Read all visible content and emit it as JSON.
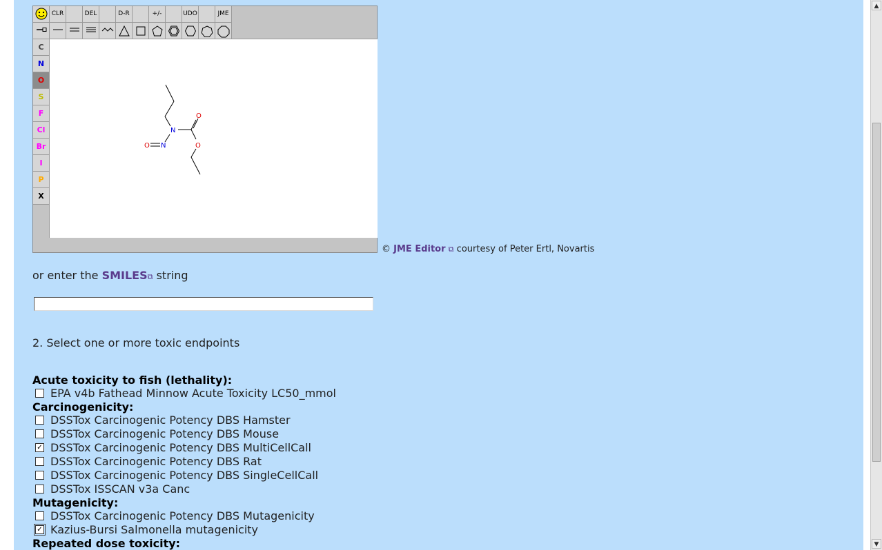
{
  "jme": {
    "top_buttons": [
      "",
      "CLR",
      "",
      "DEL",
      "",
      "D-R",
      "",
      "+/-",
      "",
      "UDO",
      "",
      "JME"
    ],
    "second_row_icons": [
      "chain-icon",
      "single-bond-icon",
      "double-bond-icon",
      "triple-bond-icon",
      "wavy-chain-icon",
      "triangle-ring-icon",
      "square-ring-icon",
      "pentagon-ring-icon",
      "benzene-ring-icon",
      "hexagon-ring-icon",
      "heptagon-ring-icon",
      "octagon-ring-icon"
    ],
    "atoms": [
      {
        "label": "C",
        "color": "#444444"
      },
      {
        "label": "N",
        "color": "#0000dd"
      },
      {
        "label": "O",
        "color": "#dd0000"
      },
      {
        "label": "S",
        "color": "#bbbb00"
      },
      {
        "label": "F",
        "color": "#ff00ff"
      },
      {
        "label": "Cl",
        "color": "#ff00ff"
      },
      {
        "label": "Br",
        "color": "#ff00ff"
      },
      {
        "label": "I",
        "color": "#ff00ff"
      },
      {
        "label": "P",
        "color": "#ffaa00"
      },
      {
        "label": "X",
        "color": "#000000"
      }
    ],
    "selected_atom": "O",
    "molecule_labels": {
      "o_top": "O",
      "n_center": "N",
      "o_ester": "O",
      "nitroso_o": "O",
      "nitroso_n": "N"
    }
  },
  "credit": {
    "copyright": "©",
    "link": "JME Editor",
    "suffix": "courtesy of Peter Ertl, Novartis"
  },
  "smiles": {
    "prefix": "or enter the",
    "link": "SMILES",
    "suffix": "string",
    "value": ""
  },
  "step2": "2. Select one or more toxic endpoints",
  "groups": [
    {
      "heading": "Acute toxicity to fish (lethality):",
      "items": [
        {
          "label": "EPA v4b Fathead Minnow Acute Toxicity LC50_mmol",
          "checked": false
        }
      ]
    },
    {
      "heading": "Carcinogenicity:",
      "items": [
        {
          "label": "DSSTox Carcinogenic Potency DBS Hamster",
          "checked": false
        },
        {
          "label": "DSSTox Carcinogenic Potency DBS Mouse",
          "checked": false
        },
        {
          "label": "DSSTox Carcinogenic Potency DBS MultiCellCall",
          "checked": true
        },
        {
          "label": "DSSTox Carcinogenic Potency DBS Rat",
          "checked": false
        },
        {
          "label": "DSSTox Carcinogenic Potency DBS SingleCellCall",
          "checked": false
        },
        {
          "label": "DSSTox ISSCAN v3a Canc",
          "checked": false
        }
      ]
    },
    {
      "heading": "Mutagenicity:",
      "items": [
        {
          "label": "DSSTox Carcinogenic Potency DBS Mutagenicity",
          "checked": false
        },
        {
          "label": "Kazius-Bursi Salmonella mutagenicity",
          "checked": true
        }
      ]
    },
    {
      "heading": "Repeated dose toxicity:",
      "items": []
    }
  ]
}
